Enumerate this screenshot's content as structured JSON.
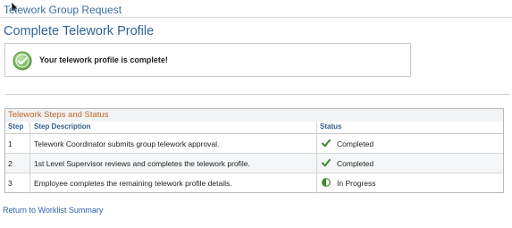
{
  "header": {
    "title": "Telework Group Request"
  },
  "page": {
    "title": "Complete Telework Profile"
  },
  "message": {
    "text": "Your telework profile is complete!",
    "icon": "check-circle-icon"
  },
  "steps": {
    "section_title": "Telework Steps and Status",
    "columns": [
      "Step",
      "Step Description",
      "Status"
    ],
    "rows": [
      {
        "step": "1",
        "description": "Telework Coordinator submits group telework approval.",
        "status": "Completed",
        "status_icon": "checkmark-icon"
      },
      {
        "step": "2",
        "description": "1st Level Supervisor reviews and completes the telework profile.",
        "status": "Completed",
        "status_icon": "checkmark-icon"
      },
      {
        "step": "3",
        "description": "Employee completes the remaining telework profile details.",
        "status": "In Progress",
        "status_icon": "in-progress-icon"
      }
    ]
  },
  "footer": {
    "return_link": "Return to Worklist Summary"
  },
  "colors": {
    "link_blue": "#2a5db0",
    "title_blue": "#2f6597",
    "section_orange": "#c0652a",
    "check_green": "#3c8c2e"
  }
}
